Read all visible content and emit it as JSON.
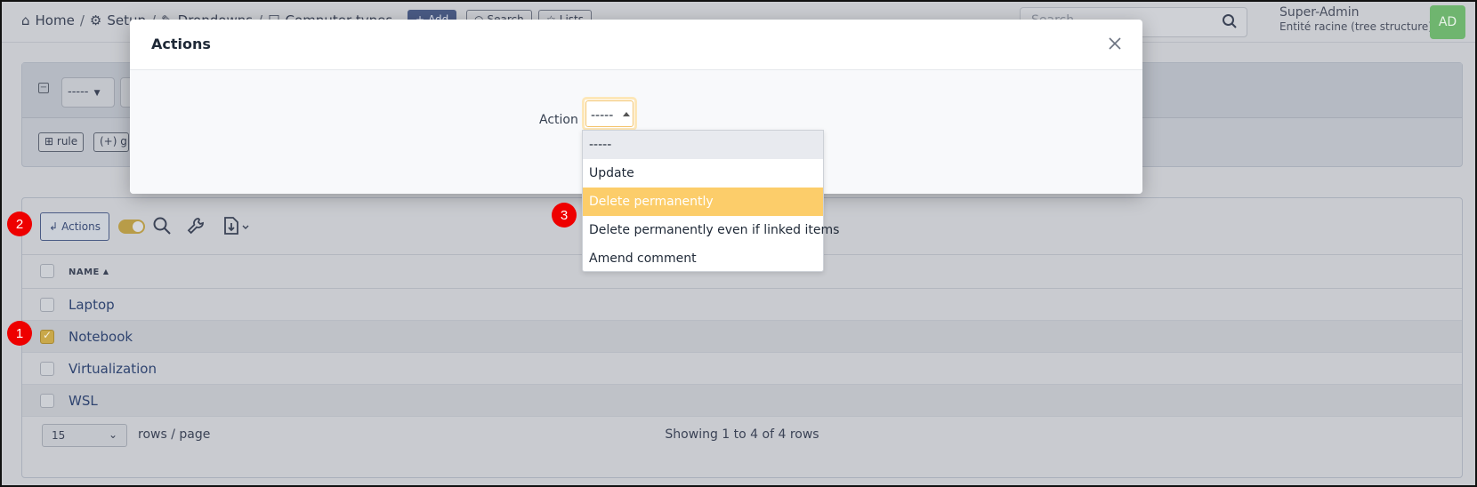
{
  "header": {
    "breadcrumbs": [
      "Home",
      "Setup",
      "Dropdowns",
      "Computer types"
    ],
    "add_label": "Add",
    "search_label": "Search",
    "lists_label": "Lists",
    "search_placeholder": "Search",
    "user_name": "Super-Admin",
    "entity": "Entité racine (tree structure)",
    "avatar_initials": "AD"
  },
  "criteria": {
    "field_value": "-----",
    "rule_label": "rule",
    "group_label": "(+) gr"
  },
  "toolbar": {
    "actions_label": "Actions"
  },
  "table": {
    "column_name": "NAME",
    "rows": [
      {
        "name": "Laptop",
        "checked": false
      },
      {
        "name": "Notebook",
        "checked": true
      },
      {
        "name": "Virtualization",
        "checked": false
      },
      {
        "name": "WSL",
        "checked": false
      }
    ]
  },
  "pagination": {
    "page_size": "15",
    "rows_per_page_label": "rows / page",
    "showing": "Showing 1 to 4 of 4 rows"
  },
  "modal": {
    "title": "Actions",
    "action_label": "Action",
    "selected_value": "-----",
    "options": [
      "-----",
      "Update",
      "Delete permanently",
      "Delete permanently even if linked items",
      "Amend comment"
    ],
    "highlighted_option": "Delete permanently"
  },
  "markers": [
    "1",
    "2",
    "3"
  ],
  "colors": {
    "highlight": "#fccd6a",
    "marker": "#ee0000",
    "primary": "#4a5b85"
  }
}
